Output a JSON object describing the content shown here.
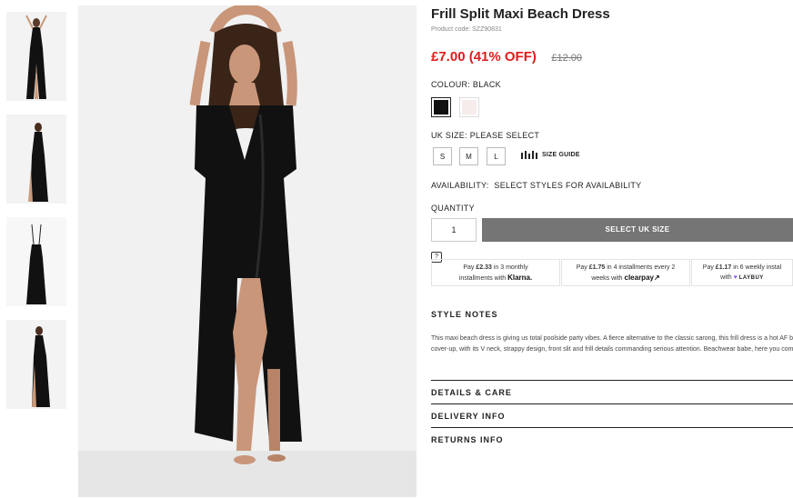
{
  "product": {
    "title": "Frill Split Maxi Beach Dress",
    "code": "Product code: SZZ90831",
    "price": "£7.00 (41% OFF)",
    "was_price": "£12.00"
  },
  "colour": {
    "label": "COLOUR:",
    "value": "BLACK",
    "swatches": [
      {
        "name": "black",
        "color": "#111111"
      },
      {
        "name": "blush",
        "color": "#f6ecec"
      }
    ]
  },
  "size": {
    "label": "UK SIZE:",
    "value": "PLEASE SELECT",
    "options": [
      "S",
      "M",
      "L"
    ],
    "guide_label": "SIZE GUIDE"
  },
  "availability": {
    "label": "AVAILABILITY:",
    "value": "SELECT STYLES FOR AVAILABILITY"
  },
  "quantity": {
    "label": "QUANTITY",
    "value": "1"
  },
  "add_button": "SELECT UK SIZE",
  "help_icon": "?",
  "payments": {
    "klarna": {
      "line1_pre": "Pay",
      "amount": "£2.33",
      "line1_post": "in 3 monthly",
      "line2": "installments with",
      "logo": "Klarna."
    },
    "clearpay": {
      "line1_pre": "Pay",
      "amount": "£1.75",
      "line1_post": "in 4 installments every 2",
      "line2": "weeks with",
      "logo": "clearpay↗"
    },
    "laybuy": {
      "line1_pre": "Pay",
      "amount": "£1.17",
      "line1_post": "in 6 weekly instal",
      "line2": "with",
      "logo": "LAYBUY"
    }
  },
  "style_notes": {
    "heading": "STYLE NOTES",
    "text": "This maxi beach dress is giving us total poolside party vibes. A fierce alternative to the classic sarong, this frill dress is a hot AF bikini cover-up, with its V neck, strappy design, front slit and frill details commanding serious attention. Beachwear babe, here you come."
  },
  "accordion": [
    {
      "label": "DETAILS & CARE"
    },
    {
      "label": "DELIVERY INFO"
    },
    {
      "label": "RETURNS INFO"
    }
  ],
  "colors": {
    "price_red": "#e01b1b",
    "button_grey": "#757575"
  }
}
